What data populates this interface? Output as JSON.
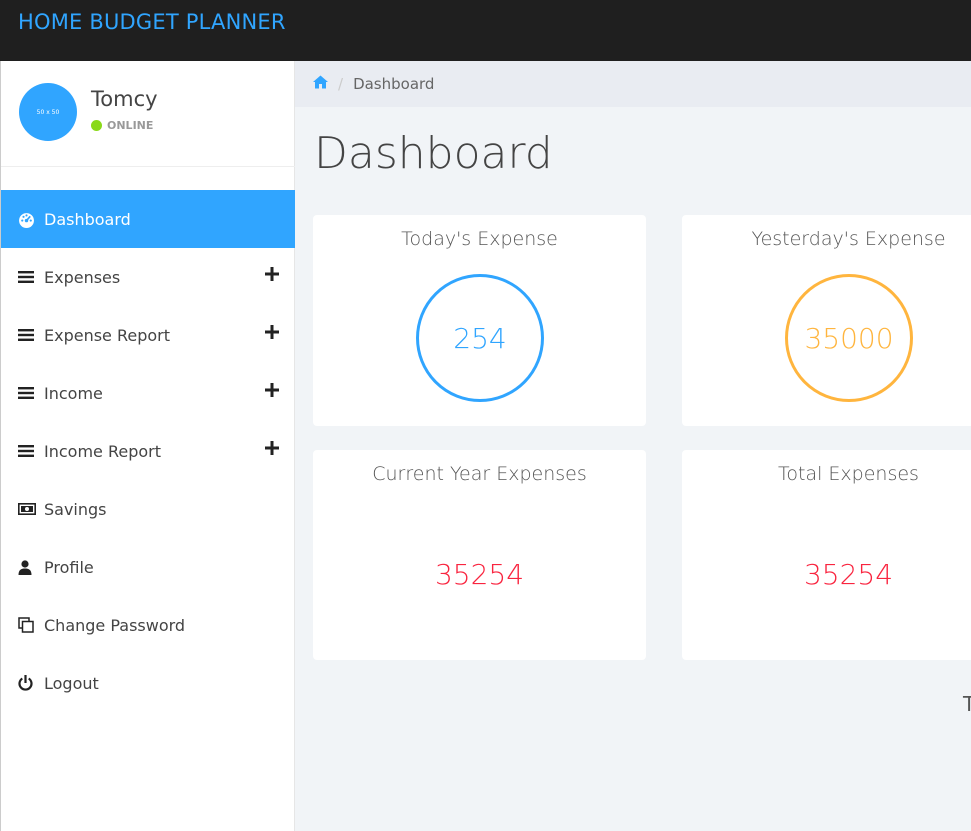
{
  "app": {
    "title": "HOME BUDGET PLANNER"
  },
  "user": {
    "avatar_text": "50 x 50",
    "name": "Tomcy",
    "status": "ONLINE"
  },
  "sidebar": {
    "items": [
      {
        "label": "Dashboard",
        "icon": "dashboard-icon",
        "active": true
      },
      {
        "label": "Expenses",
        "icon": "list-icon",
        "expandable": true
      },
      {
        "label": "Expense Report",
        "icon": "list-icon",
        "expandable": true
      },
      {
        "label": "Income",
        "icon": "list-icon",
        "expandable": true
      },
      {
        "label": "Income Report",
        "icon": "list-icon",
        "expandable": true
      },
      {
        "label": "Savings",
        "icon": "money-icon"
      },
      {
        "label": "Profile",
        "icon": "user-icon"
      },
      {
        "label": "Change Password",
        "icon": "copy-icon"
      },
      {
        "label": "Logout",
        "icon": "power-icon"
      }
    ]
  },
  "breadcrumb": {
    "home_icon": "home-icon",
    "current": "Dashboard"
  },
  "page": {
    "title": "Dashboard"
  },
  "cards": [
    {
      "title": "Today's Expense",
      "value": "254",
      "style": "ring-blue"
    },
    {
      "title": "Yesterday's Expense",
      "value": "35000",
      "style": "ring-orange"
    },
    {
      "title": "Current Year Expenses",
      "value": "35254",
      "style": "red-number"
    },
    {
      "title": "Total Expenses",
      "value": "35254",
      "style": "red-number"
    }
  ],
  "overflow_text": "T",
  "colors": {
    "accent": "#30a5ff",
    "orange": "#ffb53e",
    "red": "#f9243f",
    "online": "#8ad919",
    "topbar": "#1f1f1f"
  }
}
